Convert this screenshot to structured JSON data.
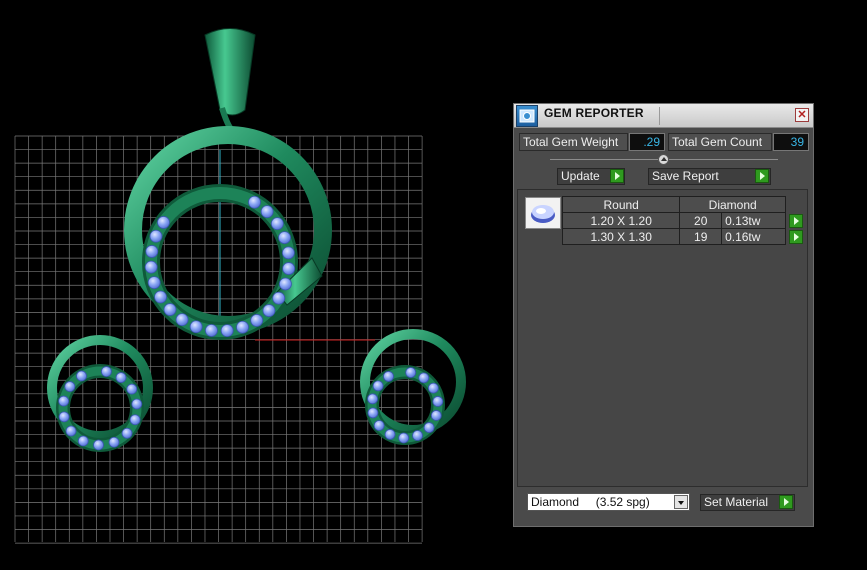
{
  "panel": {
    "title": "GEM REPORTER",
    "close_icon": "close-icon",
    "app_icon": "gem-reporter-icon",
    "total_weight_label": "Total Gem Weight",
    "total_weight_value": ".29",
    "total_count_label": "Total Gem Count",
    "total_count_value": "39",
    "update_label": "Update",
    "save_report_label": "Save Report",
    "table": {
      "headers": [
        "Round",
        "Diamond"
      ],
      "rows": [
        {
          "size": "1.20 X 1.20",
          "count": "20",
          "weight": "0.13tw"
        },
        {
          "size": "1.30 X 1.30",
          "count": "19",
          "weight": "0.16tw"
        }
      ]
    },
    "material_select": "Diamond     (3.52 spg)",
    "set_material_label": "Set Material"
  },
  "colors": {
    "metal": "#1f8a5e",
    "gem": "#7f9bf0",
    "grid": "#7a7a7a",
    "axis_red": "#cc1f1f",
    "axis_cyan": "#2fb3c8",
    "value_text": "#39b6e6",
    "go_button": "#2f9a1f"
  }
}
